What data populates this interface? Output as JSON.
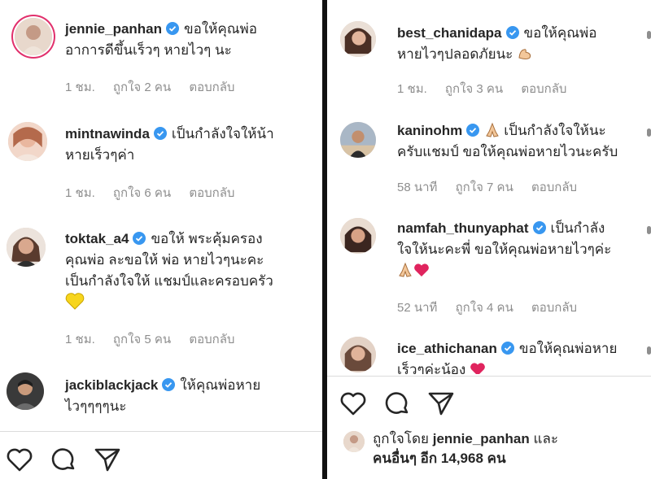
{
  "left_panel": {
    "comments": [
      {
        "username": "jennie_panhan",
        "text_line1": "ขอให้คุณพ่อ",
        "text_line2": "อาการดีขึ้นเร็วๆ หายไวๆ นะ",
        "time": "1 ชม.",
        "likes": "ถูกใจ 2 คน",
        "reply": "ตอบกลับ"
      },
      {
        "username": "mintnawinda",
        "text_line1": "เป็นกำลังใจให้น้า",
        "text_line2": "หายเร็วๆค่า",
        "time": "1 ชม.",
        "likes": "ถูกใจ 6 คน",
        "reply": "ตอบกลับ"
      },
      {
        "username": "toktak_a4",
        "text_line1": "ขอให้ พระคุ้มครอง",
        "text_line2": "คุณพ่อ ละขอให้ พ่อ หายไวๆนะคะ",
        "text_line3": "เป็นกำลังใจให้ แชมป์และครอบครัว",
        "time": "1 ชม.",
        "likes": "ถูกใจ 5 คน",
        "reply": "ตอบกลับ"
      },
      {
        "username": "jackiblackjack",
        "text_line1": "ให้คุณพ่อหาย",
        "text_line2": "ไวๆๆๆๆนะ"
      }
    ]
  },
  "right_panel": {
    "comments": [
      {
        "username": "best_chanidapa",
        "text_line1": "ขอให้คุณพ่อ",
        "text_line2": "หายไวๆปลอดภัยนะ",
        "time": "1 ชม.",
        "likes": "ถูกใจ 3 คน",
        "reply": "ตอบกลับ"
      },
      {
        "username": "kaninohm",
        "text_line1": "เป็นกำลังใจให้นะ",
        "text_line2": "ครับแชมป์ ขอให้คุณพ่อหายไวนะครับ",
        "time": "58 นาที",
        "likes": "ถูกใจ 7 คน",
        "reply": "ตอบกลับ"
      },
      {
        "username": "namfah_thunyaphat",
        "text_line1": "เป็นกำลัง",
        "text_line2": "ใจให้นะคะพี่ ขอให้คุณพ่อหายไวๆค่ะ",
        "time": "52 นาที",
        "likes": "ถูกใจ 4 คน",
        "reply": "ตอบกลับ"
      },
      {
        "username": "ice_athichanan",
        "text_line1": "ขอให้คุณพ่อหาย",
        "text_line2": "เร็วๆค่ะน้อง"
      }
    ],
    "liked_by": {
      "prefix": "ถูกใจโดย",
      "user": "jennie_panhan",
      "and": "และ",
      "others": "คนอื่นๆ อีก 14,968 คน"
    }
  },
  "colors": {
    "verified_blue": "#3897f0",
    "heart_red": "#e0245e",
    "emoji_yellow": "#f7d51d",
    "meta_gray": "#8e8e8e"
  },
  "icons": {
    "like": "heart-outline-icon",
    "comment": "comment-bubble-icon",
    "share": "paper-plane-icon",
    "verified": "verified-badge-icon"
  }
}
